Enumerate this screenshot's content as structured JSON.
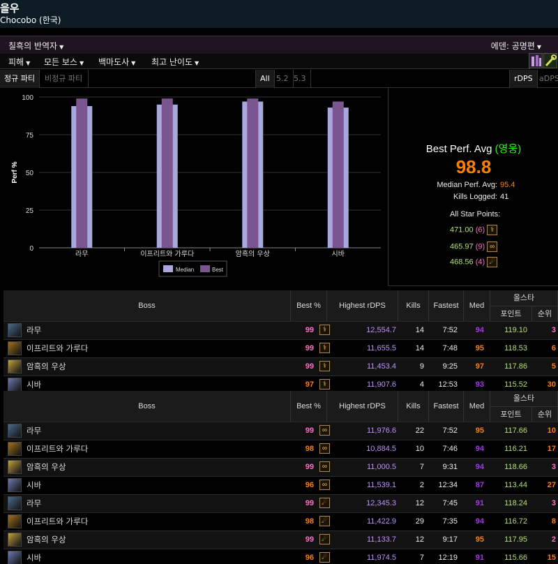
{
  "header": {
    "char_name": "을우",
    "server": "Chocobo (한국)"
  },
  "zonebar": {
    "zone": "칠흑의 반역자",
    "partition": "에덴: 공명편"
  },
  "menu": [
    {
      "label": "피해"
    },
    {
      "label": "모든 보스"
    },
    {
      "label": "백마도사"
    },
    {
      "label": "최고 난이도"
    }
  ],
  "filters": {
    "party_active": "정규 파티",
    "party_other": "비정규 파티",
    "patches": [
      "All",
      "5.2",
      "5.3"
    ],
    "metric_active": "rDPS",
    "metric_other": "aDPS"
  },
  "chart_data": {
    "type": "bar",
    "categories": [
      "라무",
      "이프리트와 가루다",
      "암흑의 우상",
      "시바"
    ],
    "series": [
      {
        "name": "Median",
        "values": [
          94,
          95,
          97,
          93
        ]
      },
      {
        "name": "Best",
        "values": [
          99,
          99,
          99,
          97
        ]
      }
    ],
    "ylabel": "Perf %",
    "ylim": [
      0,
      100
    ],
    "yticks": [
      0,
      25,
      50,
      75,
      100
    ],
    "colors": {
      "Median": "#a8a8dc",
      "Best": "#7b5590"
    },
    "legend": "bottom"
  },
  "summary": {
    "title": "Best Perf. Avg",
    "title_paren": "(영웅)",
    "best_avg": "98.8",
    "median_label": "Median Perf. Avg:",
    "median_val": "95.4",
    "kills_label": "Kills Logged:",
    "kills_val": "41",
    "asp_title": "All Star Points:",
    "asp": [
      {
        "points": "471.00",
        "rank": "(6)",
        "job_icon": "whm-icon"
      },
      {
        "points": "465.97",
        "rank": "(9)",
        "job_icon": "sch-icon"
      },
      {
        "points": "468.56",
        "rank": "(4)",
        "job_icon": "ast-icon"
      }
    ]
  },
  "table_headers": {
    "boss": "Boss",
    "best": "Best %",
    "highest": "Highest rDPS",
    "kills": "Kills",
    "fastest": "Fastest",
    "med": "Med",
    "allstar": "올스타",
    "points": "포인트",
    "rank": "순위"
  },
  "table1": [
    {
      "boss": "라무",
      "best": "99",
      "dps": "12,554.7",
      "kills": "14",
      "fastest": "7:52",
      "med": "94",
      "points": "119.10",
      "rank": "3"
    },
    {
      "boss": "이프리트와 가루다",
      "best": "99",
      "dps": "11,655.5",
      "kills": "14",
      "fastest": "7:48",
      "med": "95",
      "points": "118.53",
      "rank": "6"
    },
    {
      "boss": "암흑의 우상",
      "best": "99",
      "dps": "11,453.4",
      "kills": "9",
      "fastest": "9:25",
      "med": "97",
      "points": "117.86",
      "rank": "5"
    },
    {
      "boss": "시바",
      "best": "97",
      "dps": "11,907.6",
      "kills": "4",
      "fastest": "12:53",
      "med": "93",
      "points": "115.52",
      "rank": "30"
    }
  ],
  "table2": [
    {
      "boss": "라무",
      "best": "99",
      "dps": "11,976.6",
      "kills": "22",
      "fastest": "7:52",
      "med": "95",
      "points": "117.66",
      "rank": "10"
    },
    {
      "boss": "이프리트와 가루다",
      "best": "98",
      "dps": "10,884.5",
      "kills": "10",
      "fastest": "7:46",
      "med": "94",
      "points": "116.21",
      "rank": "17"
    },
    {
      "boss": "암흑의 우상",
      "best": "99",
      "dps": "11,000.5",
      "kills": "7",
      "fastest": "9:31",
      "med": "94",
      "points": "118.66",
      "rank": "3"
    },
    {
      "boss": "시바",
      "best": "96",
      "dps": "11,539.1",
      "kills": "2",
      "fastest": "12:34",
      "med": "87",
      "points": "113.44",
      "rank": "27"
    },
    {
      "boss": "라무",
      "best": "99",
      "dps": "12,345.3",
      "kills": "12",
      "fastest": "7:45",
      "med": "91",
      "points": "118.24",
      "rank": "3"
    },
    {
      "boss": "이프리트와 가루다",
      "best": "98",
      "dps": "11,422.9",
      "kills": "29",
      "fastest": "7:35",
      "med": "94",
      "points": "116.72",
      "rank": "8"
    },
    {
      "boss": "암흑의 우상",
      "best": "99",
      "dps": "11,133.7",
      "kills": "12",
      "fastest": "9:17",
      "med": "95",
      "points": "117.95",
      "rank": "2"
    },
    {
      "boss": "시바",
      "best": "96",
      "dps": "11,974.5",
      "kills": "7",
      "fastest": "12:19",
      "med": "91",
      "points": "115.66",
      "rank": "15"
    }
  ],
  "table2_jobs": [
    "sch-icon",
    "sch-icon",
    "sch-icon",
    "sch-icon",
    "ast-icon",
    "ast-icon",
    "ast-icon",
    "ast-icon"
  ]
}
